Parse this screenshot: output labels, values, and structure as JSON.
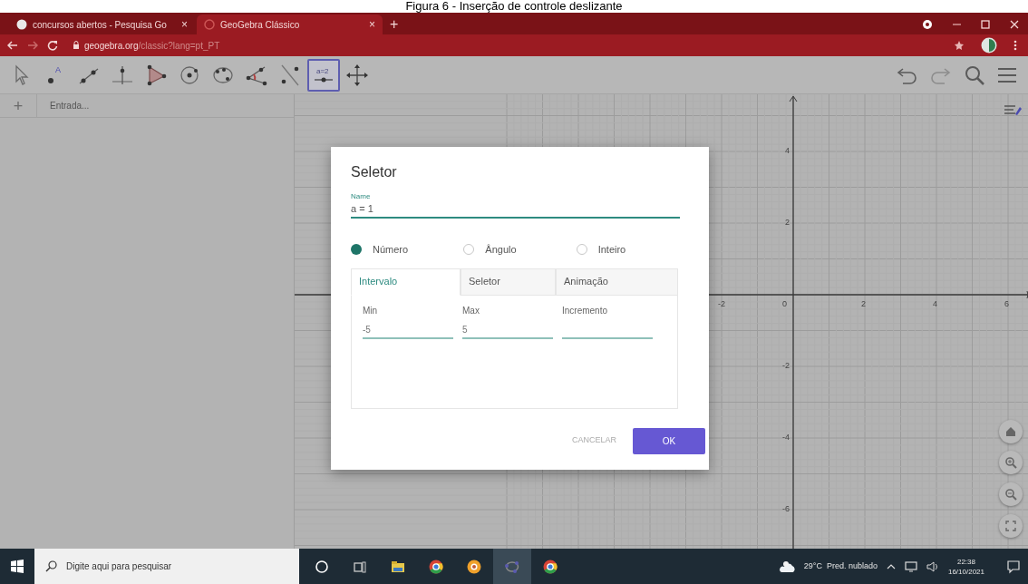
{
  "caption": "Figura 6 - Inserção de controle deslizante",
  "browser": {
    "tabs": [
      {
        "title": "concursos abertos - Pesquisa Go",
        "close": "×",
        "selected": false
      },
      {
        "title": "GeoGebra Clássico",
        "close": "×",
        "selected": true
      }
    ],
    "new_tab": "+",
    "url_host": "geogebra.org",
    "url_path": "/classic?lang=pt_PT"
  },
  "toolbar": {
    "tools": [
      {
        "kind": "move",
        "selected": false
      },
      {
        "kind": "point",
        "label": "A",
        "selected": false
      },
      {
        "kind": "line",
        "selected": false
      },
      {
        "kind": "perpendicular",
        "selected": false
      },
      {
        "kind": "polygon",
        "selected": false
      },
      {
        "kind": "circle",
        "selected": false
      },
      {
        "kind": "conic",
        "selected": false
      },
      {
        "kind": "angle",
        "selected": false
      },
      {
        "kind": "reflect",
        "selected": false
      },
      {
        "kind": "slider",
        "label": "a=2",
        "selected": true
      },
      {
        "kind": "move_view",
        "selected": false
      }
    ]
  },
  "algebra": {
    "add": "+",
    "placeholder": "Entrada..."
  },
  "graphics": {
    "x_labels": [
      "-2",
      "0",
      "2",
      "4",
      "6"
    ],
    "y_labels": [
      "4",
      "2",
      "-2",
      "-4",
      "-6"
    ]
  },
  "dialog": {
    "title": "Seletor",
    "name_label": "Name",
    "name_value": "a = 1",
    "types": [
      {
        "label": "Número",
        "selected": true
      },
      {
        "label": "Ângulo",
        "selected": false
      },
      {
        "label": "Inteiro",
        "selected": false
      }
    ],
    "tabs": [
      {
        "label": "Intervalo",
        "selected": true
      },
      {
        "label": "Seletor",
        "selected": false
      },
      {
        "label": "Animação",
        "selected": false
      }
    ],
    "fields": [
      {
        "label": "Min",
        "value": "-5"
      },
      {
        "label": "Max",
        "value": "5"
      },
      {
        "label": "Incremento"
      }
    ],
    "cancel": "CANCELAR",
    "ok": "OK"
  },
  "taskbar": {
    "search_placeholder": "Digite aqui para pesquisar",
    "apps": [
      {
        "kind": "cortana"
      },
      {
        "kind": "taskview"
      },
      {
        "kind": "explorer"
      },
      {
        "kind": "chrome"
      },
      {
        "kind": "orange"
      },
      {
        "kind": "geogebra"
      },
      {
        "kind": "chrome"
      }
    ],
    "weather": "29°C  Pred. nublado",
    "time": "22:38",
    "date": "16/10/2021"
  }
}
